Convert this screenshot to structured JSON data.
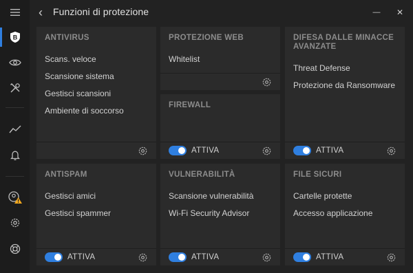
{
  "window": {
    "title": "Funzioni di protezione",
    "minimize_glyph": "—",
    "close_glyph": "✕",
    "back_glyph": "‹"
  },
  "sidebar": {
    "items": [
      {
        "icon": "menu-icon",
        "active": false
      },
      {
        "icon": "shield-b-icon",
        "active": true
      },
      {
        "icon": "eye-icon",
        "active": false
      },
      {
        "icon": "tools-icon",
        "active": false
      },
      {
        "icon": "activity-icon",
        "active": false
      },
      {
        "icon": "bell-icon",
        "active": false
      },
      {
        "icon": "account-warning-icon",
        "active": false
      },
      {
        "icon": "settings-icon",
        "active": false
      },
      {
        "icon": "support-icon",
        "active": false
      }
    ]
  },
  "colors": {
    "accent": "#2f7fe0",
    "warning": "#f2a81d",
    "card_bg": "#2b2b2b",
    "app_bg": "#222222"
  },
  "cards": {
    "antivirus": {
      "title": "ANTIVIRUS",
      "items": [
        "Scans. veloce",
        "Scansione sistema",
        "Gestisci scansioni",
        "Ambiente di soccorso"
      ]
    },
    "web": {
      "title": "PROTEZIONE WEB",
      "items": [
        "Whitelist"
      ]
    },
    "threat": {
      "title_line1": "DIFESA DALLE MINACCE",
      "title_line2": "AVANZATE",
      "items": [
        "Threat Defense",
        "Protezione da Ransomware"
      ],
      "toggle_label": "ATTIVA",
      "toggle_on": true
    },
    "firewall": {
      "title": "FIREWALL",
      "toggle_label": "ATTIVA",
      "toggle_on": true
    },
    "antispam": {
      "title": "ANTISPAM",
      "items": [
        "Gestisci amici",
        "Gestisci spammer"
      ],
      "toggle_label": "ATTIVA",
      "toggle_on": true
    },
    "vulnerability": {
      "title": "VULNERABILITÀ",
      "items": [
        "Scansione vulnerabilità",
        "Wi-Fi Security Advisor"
      ],
      "toggle_label": "ATTIVA",
      "toggle_on": true
    },
    "safefiles": {
      "title": "FILE SICURI",
      "items": [
        "Cartelle protette",
        "Accesso applicazione"
      ],
      "toggle_label": "ATTIVA",
      "toggle_on": true
    }
  }
}
